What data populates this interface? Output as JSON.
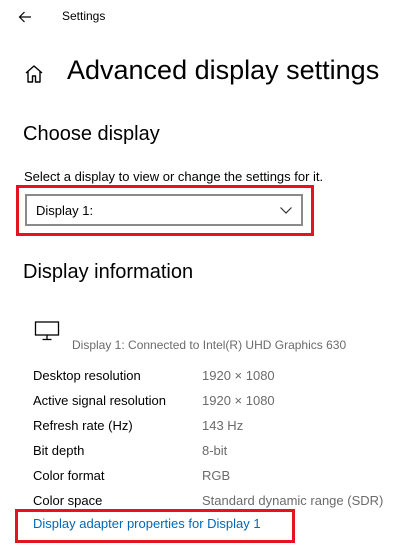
{
  "titlebar": {
    "back_icon": "back-arrow-icon",
    "app_title": "Settings"
  },
  "header": {
    "home_icon": "home-icon",
    "title": "Advanced display settings"
  },
  "choose_display": {
    "heading": "Choose display",
    "description": "Select a display to view or change the settings for it.",
    "dropdown_value": "Display 1:",
    "dropdown_icon": "chevron-down-icon"
  },
  "display_info": {
    "heading": "Display information",
    "monitor_icon": "monitor-icon",
    "connected_text": "Display 1: Connected to Intel(R) UHD Graphics 630",
    "rows": [
      {
        "label": "Desktop resolution",
        "value": "1920 × 1080"
      },
      {
        "label": "Active signal resolution",
        "value": "1920 × 1080"
      },
      {
        "label": "Refresh rate (Hz)",
        "value": "143 Hz"
      },
      {
        "label": "Bit depth",
        "value": "8-bit"
      },
      {
        "label": "Color format",
        "value": "RGB"
      },
      {
        "label": "Color space",
        "value": "Standard dynamic range (SDR)"
      }
    ],
    "adapter_link": "Display adapter properties for Display 1"
  },
  "colors": {
    "highlight": "#e3141f",
    "link": "#0067b8",
    "secondary_text": "#6b6b6b"
  }
}
